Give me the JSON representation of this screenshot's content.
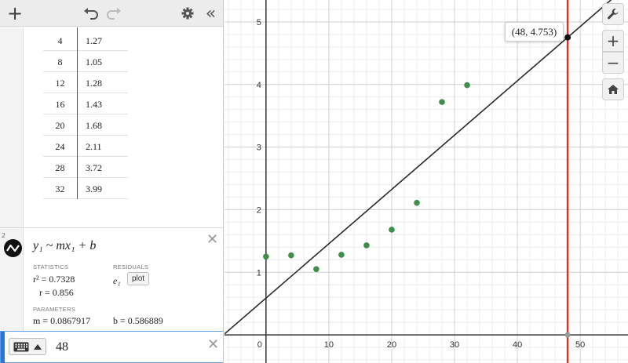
{
  "toolbar": {
    "add_label": "+",
    "collapse_label": "«"
  },
  "table": {
    "rows": [
      {
        "x": "4",
        "y": "1.27"
      },
      {
        "x": "8",
        "y": "1.05"
      },
      {
        "x": "12",
        "y": "1.28"
      },
      {
        "x": "16",
        "y": "1.43"
      },
      {
        "x": "20",
        "y": "1.68"
      },
      {
        "x": "24",
        "y": "2.11"
      },
      {
        "x": "28",
        "y": "3.72"
      },
      {
        "x": "32",
        "y": "3.99"
      }
    ]
  },
  "regression": {
    "expression_number": "2",
    "formula": "y₁ ~ mx₁ + b",
    "statistics_caption": "STATISTICS",
    "residuals_caption": "RESIDUALS",
    "r2": "r² = 0.7328",
    "r": "r = 0.856",
    "residual_var": "e₁",
    "plot_button": "plot",
    "parameters_caption": "PARAMETERS",
    "m": "m = 0.0867917",
    "b": "b = 0.586889"
  },
  "expression3": {
    "value": "48"
  },
  "graph": {
    "point_label": "(48, 4.753)",
    "x_ticks": [
      "0",
      "10",
      "20",
      "30",
      "40",
      "50"
    ],
    "y_ticks": [
      "1",
      "2",
      "3",
      "4",
      "5"
    ],
    "colors": {
      "points": "#3f8e4c",
      "line": "#2a2a2a",
      "vertical": "#c23b32",
      "marker": "#111111"
    }
  },
  "tools": [
    "wrench-icon",
    "zoom-in-icon",
    "zoom-out-icon",
    "home-icon"
  ],
  "chart_data": {
    "type": "scatter",
    "series": [
      {
        "x": [
          0,
          4,
          8,
          12,
          16,
          20,
          24,
          28,
          32
        ],
        "y": [
          1.25,
          1.27,
          1.05,
          1.28,
          1.43,
          1.68,
          2.11,
          3.72,
          3.99
        ]
      }
    ],
    "regression_line": {
      "m": 0.0867917,
      "b": 0.586889
    },
    "vertical_line_x": 48,
    "highlight_point": {
      "x": 48,
      "y": 4.753
    },
    "xlim": [
      -6.6,
      57.6
    ],
    "ylim": [
      -0.45,
      5.35
    ],
    "grid": true
  }
}
